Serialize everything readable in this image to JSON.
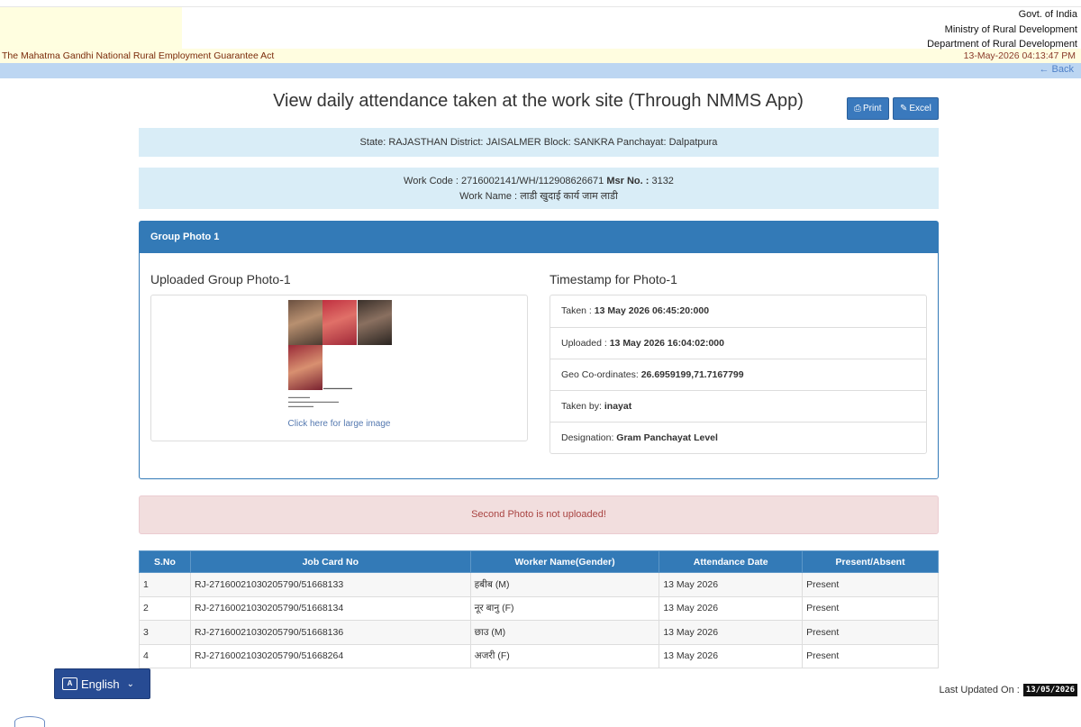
{
  "header": {
    "govt_lines": [
      "Govt. of India",
      "Ministry of Rural Development",
      "Department of Rural Development"
    ],
    "act_title": "The Mahatma Gandhi National Rural Employment Guarantee Act",
    "datetime": "13-May-2026 04:13:47 PM",
    "back_label": "Back"
  },
  "page": {
    "title": "View daily attendance taken at the work site (Through NMMS App)",
    "print_label": "Print",
    "excel_label": "Excel"
  },
  "location": {
    "state_label": "State:",
    "state": "RAJASTHAN",
    "district_label": "District:",
    "district": "JAISALMER",
    "block_label": "Block:",
    "block": "SANKRA",
    "panchayat_label": "Panchayat:",
    "panchayat": "Dalpatpura"
  },
  "work": {
    "code_label": "Work Code :",
    "code": "2716002141/WH/112908626671",
    "msr_label": "Msr No. :",
    "msr": "3132",
    "name_label": "Work Name :",
    "name": "लाडी खुदाई कार्य जाम लाडी"
  },
  "group_photo": {
    "panel_title": "Group Photo 1",
    "uploaded_label": "Uploaded Group Photo-1",
    "large_link": "Click here for large image",
    "timestamp_label": "Timestamp for Photo-1",
    "timestamp_items": [
      {
        "label": "Taken :",
        "value": "13 May 2026 06:45:20:000"
      },
      {
        "label": "Uploaded :",
        "value": "13 May 2026 16:04:02:000"
      },
      {
        "label": "Geo Co-ordinates:",
        "value": "26.6959199,71.7167799"
      },
      {
        "label": "Taken by:",
        "value": "inayat"
      },
      {
        "label": "Designation:",
        "value": "Gram Panchayat Level"
      }
    ]
  },
  "alert": "Second Photo is not uploaded!",
  "table": {
    "headers": [
      "S.No",
      "Job Card No",
      "Worker Name(Gender)",
      "Attendance Date",
      "Present/Absent"
    ],
    "rows": [
      [
        "1",
        "RJ-27160021030205790/51668133",
        "हबीब (M)",
        "13 May 2026",
        "Present"
      ],
      [
        "2",
        "RJ-27160021030205790/51668134",
        "नूर बानु (F)",
        "13 May 2026",
        "Present"
      ],
      [
        "3",
        "RJ-27160021030205790/51668136",
        "छाउ (M)",
        "13 May 2026",
        "Present"
      ],
      [
        "4",
        "RJ-27160021030205790/51668264",
        "अजरी (F)",
        "13 May 2026",
        "Present"
      ]
    ]
  },
  "language": {
    "label": "English"
  },
  "footer": {
    "last_updated_label": "Last Updated On :",
    "last_updated": "13/05/2026"
  },
  "icons": {
    "back": "arrow-left-icon",
    "print": "printer-icon",
    "excel": "excel-icon",
    "language": "translate-icon",
    "dropdown": "chevron-down-icon"
  },
  "colors": {
    "primary": "#337ab7",
    "info_bg": "#d9edf7",
    "alert_bg": "#f2dede",
    "alert_text": "#a94442",
    "header_yellow": "#fffde0",
    "nav_bar": "#bcd6f2"
  }
}
